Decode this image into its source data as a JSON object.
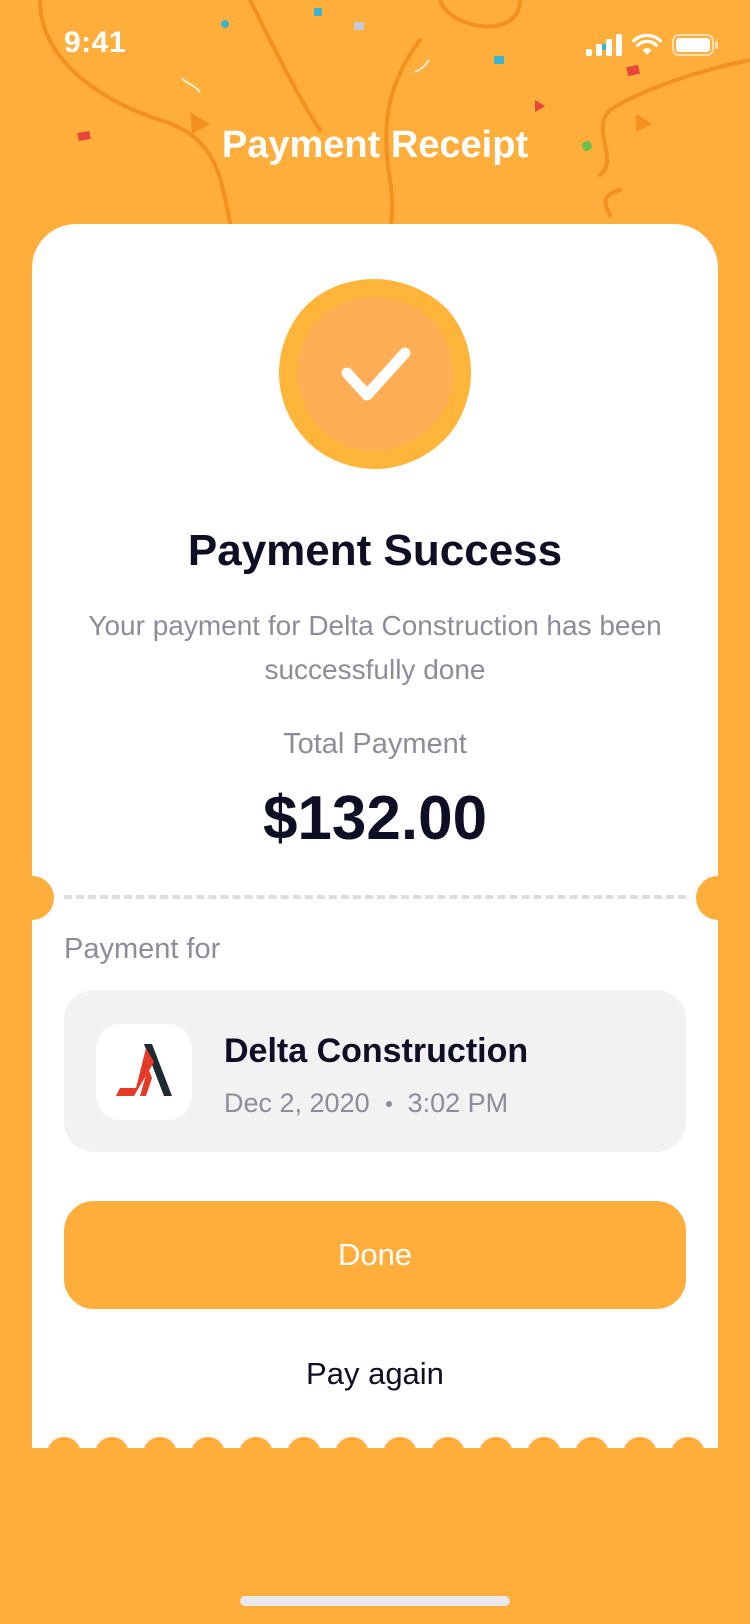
{
  "status_bar": {
    "time": "9:41",
    "icons": [
      "signal-icon",
      "wifi-icon",
      "battery-icon"
    ]
  },
  "header": {
    "title": "Payment Receipt"
  },
  "receipt": {
    "status_icon": "check-badge-icon",
    "title": "Payment Success",
    "description": "Your payment for Delta Construction has been successfully done",
    "total_label": "Total Payment",
    "total_amount": "$132.00",
    "payment_for_label": "Payment for",
    "merchant": {
      "name": "Delta Construction",
      "date": "Dec 2, 2020",
      "time": "3:02 PM",
      "logo_icon": "delta-construction-logo"
    }
  },
  "actions": {
    "done_label": "Done",
    "pay_again_label": "Pay again"
  },
  "colors": {
    "brand": "#FFAD3B",
    "text_primary": "#0E0E24",
    "text_secondary": "#8B8D99",
    "merchant_bg": "#F2F2F3"
  }
}
